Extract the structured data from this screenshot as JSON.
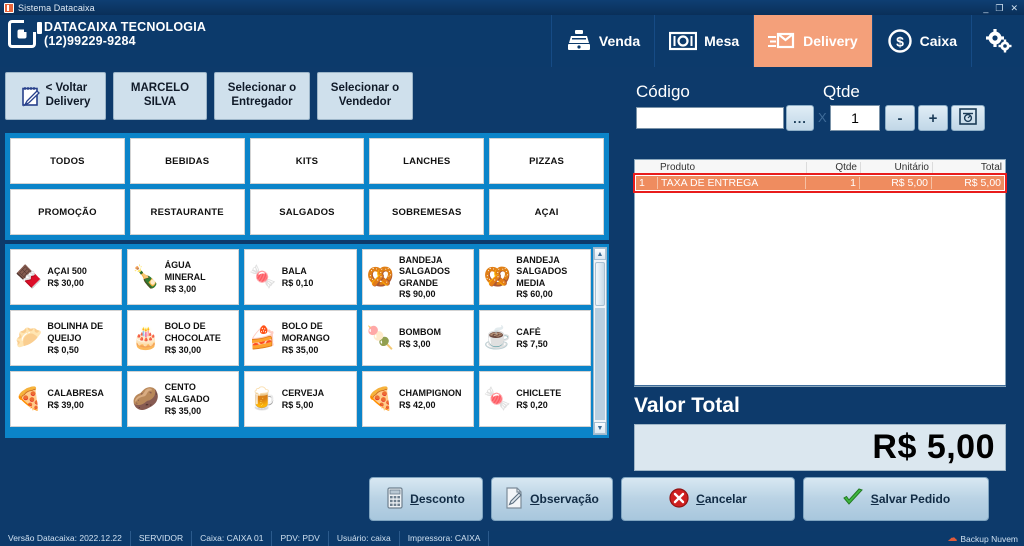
{
  "window": {
    "title": "Sistema Datacaixa",
    "minimize": "_",
    "maximize": "❐",
    "close": "✕"
  },
  "header": {
    "company_name": "DATACAIXA TECNOLOGIA",
    "phone": "(12)99229-9284",
    "nav": [
      {
        "label": "Venda",
        "icon": "cash-register-icon",
        "active": false
      },
      {
        "label": "Mesa",
        "icon": "dining-table-icon",
        "active": false
      },
      {
        "label": "Delivery",
        "icon": "delivery-box-icon",
        "active": true
      },
      {
        "label": "Caixa",
        "icon": "dollar-circle-icon",
        "active": false
      }
    ],
    "settings_icon": "gears-icon",
    "active_color": "#f4a07a"
  },
  "toolbar": {
    "back_label": "< Voltar\nDelivery",
    "back_line1": "< Voltar",
    "back_line2": "Delivery",
    "customer": "MARCELO SILVA",
    "deliverer_line1": "Selecionar o",
    "deliverer_line2": "Entregador",
    "seller_line1": "Selecionar o",
    "seller_line2": "Vendedor"
  },
  "categories": [
    "TODOS",
    "BEBIDAS",
    "KITS",
    "LANCHES",
    "PIZZAS",
    "PROMOÇÃO",
    "RESTAURANTE",
    "SALGADOS",
    "SOBREMESAS",
    "AÇAI"
  ],
  "products": [
    {
      "name": "AÇAI 500",
      "price": "R$ 30,00",
      "emoji": "🍫"
    },
    {
      "name": "ÁGUA\nMINERAL",
      "price": "R$ 3,00",
      "emoji": "🍾"
    },
    {
      "name": "BALA",
      "price": "R$ 0,10",
      "emoji": "🍬"
    },
    {
      "name": "BANDEJA\nSALGADOS\nGRANDE",
      "price": "R$ 90,00",
      "emoji": "🥨"
    },
    {
      "name": "BANDEJA\nSALGADOS\nMEDIA",
      "price": "R$ 60,00",
      "emoji": "🥨"
    },
    {
      "name": "BOLINHA DE\nQUEIJO",
      "price": "R$ 0,50",
      "emoji": "🥟"
    },
    {
      "name": "BOLO DE\nCHOCOLATE",
      "price": "R$ 30,00",
      "emoji": "🎂"
    },
    {
      "name": "BOLO DE\nMORANGO",
      "price": "R$ 35,00",
      "emoji": "🍰"
    },
    {
      "name": "BOMBOM",
      "price": "R$ 3,00",
      "emoji": "🍡"
    },
    {
      "name": "CAFÉ",
      "price": "R$ 7,50",
      "emoji": "☕"
    },
    {
      "name": "CALABRESA",
      "price": "R$ 39,00",
      "emoji": "🍕"
    },
    {
      "name": "CENTO\nSALGADO",
      "price": "R$ 35,00",
      "emoji": "🥔"
    },
    {
      "name": "CERVEJA",
      "price": "R$ 5,00",
      "emoji": "🍺"
    },
    {
      "name": "CHAMPIGNON",
      "price": "R$ 42,00",
      "emoji": "🍕"
    },
    {
      "name": "CHICLETE",
      "price": "R$ 0,20",
      "emoji": "🍬"
    }
  ],
  "order_panel": {
    "codigo_label": "Código",
    "codigo_value": "",
    "codigo_placeholder": "",
    "browse_button": "...",
    "multiply_symbol": "X",
    "qtde_label": "Qtde",
    "qtde_value": "1",
    "minus_button": "-",
    "plus_button": "+",
    "scale_icon": "scale-icon",
    "grid": {
      "columns": [
        "",
        "Produto",
        "Qtde",
        "Unitário",
        "Total"
      ],
      "rows": [
        {
          "num": "1",
          "produto": "TAXA DE ENTREGA",
          "qtde": "1",
          "unitario": "R$ 5,00",
          "total": "R$ 5,00",
          "selected": true
        }
      ]
    },
    "valor_total_label": "Valor Total",
    "valor_total_value": "R$ 5,00"
  },
  "action_buttons": {
    "desconto": {
      "label": "Desconto",
      "accel": "D",
      "icon": "calculator-icon"
    },
    "observacao": {
      "label": "Observação",
      "accel": "O",
      "icon": "note-pencil-icon"
    },
    "cancelar": {
      "label": "Cancelar",
      "accel": "C",
      "icon": "red-x-icon"
    },
    "salvar": {
      "label": "Salvar Pedido",
      "accel": "S",
      "icon": "green-check-icon"
    }
  },
  "statusbar": {
    "version": "Versão Datacaixa: 2022.12.22",
    "server": "SERVIDOR",
    "caixa": "Caixa: CAIXA 01",
    "pdv": "PDV: PDV",
    "usuario": "Usuário: caixa",
    "impressora": "Impressora: CAIXA",
    "backup": "Backup Nuvem"
  }
}
